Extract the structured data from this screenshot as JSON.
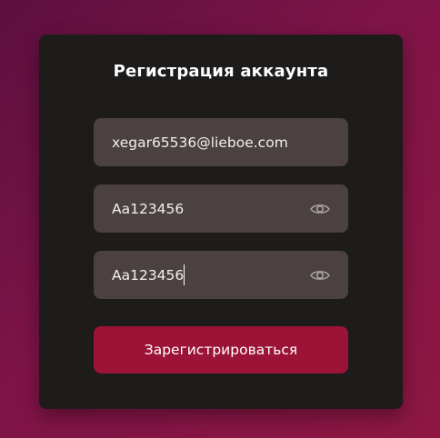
{
  "form": {
    "title": "Регистрация аккаунта",
    "email": {
      "value": "xegar65536@lieboe.com"
    },
    "password": {
      "value": "Aa123456",
      "eye_icon": "eye-icon"
    },
    "password_confirm": {
      "value": "Aa123456",
      "eye_icon": "eye-icon",
      "focused": true
    },
    "submit_label": "Зарегистрироваться"
  },
  "colors": {
    "background_start": "#5c0f40",
    "background_end": "#8e1742",
    "card": "#1e1b1b",
    "field": "#4a4140",
    "button": "#9b1337",
    "text": "#ffffff",
    "icon": "#a9a2a2"
  }
}
